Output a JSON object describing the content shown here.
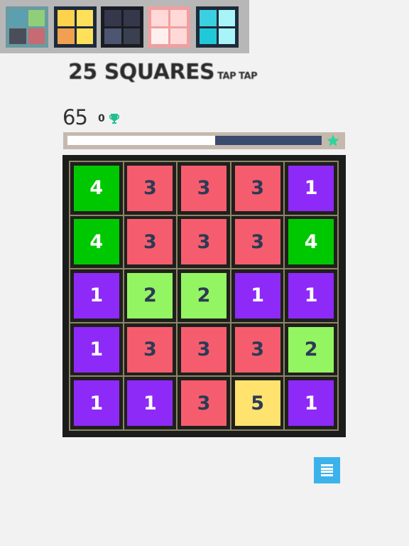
{
  "themes": [
    {
      "name": "theme-gray-pastel",
      "bg": "#6a9aa2",
      "colors": [
        "#5aa0b0",
        "#8fcf7a",
        "#4a4e5a",
        "#c86a72"
      ]
    },
    {
      "name": "theme-warm",
      "bg": "#1d2a3a",
      "colors": [
        "#ffd24e",
        "#ffe05a",
        "#f0a050",
        "#ffe05a"
      ]
    },
    {
      "name": "theme-dark",
      "bg": "#1a1c22",
      "colors": [
        "#34384a",
        "#34384a",
        "#4c5670",
        "#3a4050"
      ]
    },
    {
      "name": "theme-pink",
      "bg": "#f0a0a0",
      "colors": [
        "#ffd8d8",
        "#ffd8d8",
        "#fff0f0",
        "#ffd8d8"
      ]
    },
    {
      "name": "theme-cyan",
      "bg": "#1d2a3a",
      "colors": [
        "#3ad0e0",
        "#a8f4f8",
        "#20c8d8",
        "#a8f4f8"
      ]
    }
  ],
  "title": {
    "main": "25 SQUARES",
    "sub": "TAP TAP"
  },
  "score": "65",
  "best": "0",
  "progress": 0.42,
  "tile_styles": {
    "1": {
      "bg": "#8e2af7",
      "fg": "#ffffff"
    },
    "2": {
      "bg": "#94f562",
      "fg": "#2c3a55"
    },
    "3": {
      "bg": "#f55d6e",
      "fg": "#2c3a55"
    },
    "4": {
      "bg": "#00c800",
      "fg": "#ffffff"
    },
    "5": {
      "bg": "#ffe36e",
      "fg": "#2c3a55"
    }
  },
  "board": [
    [
      "4",
      "3",
      "3",
      "3",
      "1"
    ],
    [
      "4",
      "3",
      "3",
      "3",
      "4"
    ],
    [
      "1",
      "2",
      "2",
      "1",
      "1"
    ],
    [
      "1",
      "3",
      "3",
      "3",
      "2"
    ],
    [
      "1",
      "1",
      "3",
      "5",
      "1"
    ]
  ],
  "colors": {
    "accent": "#3bb3ea",
    "progress_fill": "#3a4b6e",
    "trophy": "#1fbf8f",
    "star": "#2ed49a"
  }
}
